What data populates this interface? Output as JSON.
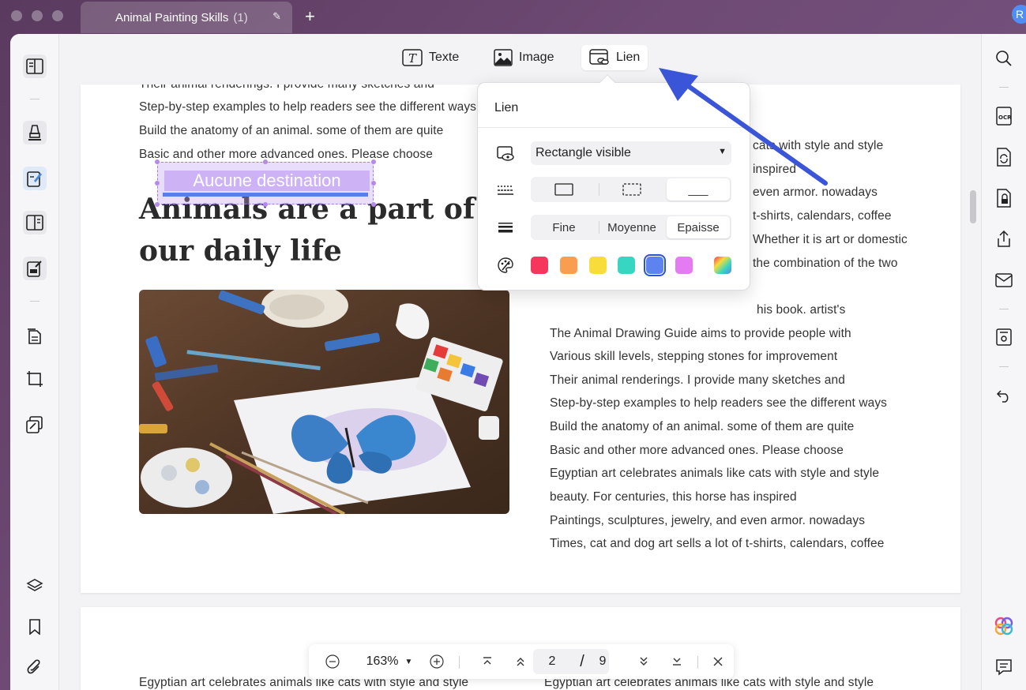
{
  "window": {
    "tab_title": "Animal Painting Skills",
    "tab_count": "(1)",
    "avatar_letter": "R"
  },
  "toolbar": {
    "text_label": "Texte",
    "image_label": "Image",
    "link_label": "Lien"
  },
  "popup": {
    "title": "Lien",
    "visibility_value": "Rectangle visible",
    "style_underline_label": "___",
    "thickness": [
      "Fine",
      "Moyenne",
      "Epaisse"
    ],
    "thickness_selected": "Epaisse",
    "colors": [
      "#f5375e",
      "#f99d4f",
      "#f7dc3a",
      "#36d6c2",
      "#5c83ee",
      "#e57bf2"
    ],
    "color_selected": "#5c83ee"
  },
  "document": {
    "link_placeholder": "Aucune destination",
    "heading": "Animals are a part of our daily life",
    "left_lines": [
      "Their animal renderings. I provide many sketches and",
      "Step-by-step examples to help readers see the different ways",
      "Build the anatomy of an animal. some of them are quite",
      "Basic and other more advanced ones. Please choose"
    ],
    "right_top_lines": [
      "cats with style and style",
      "inspired",
      "even armor. nowadays",
      "t-shirts, calendars, coffee",
      "Whether it is art or domestic",
      "the combination of the two"
    ],
    "right_lines": [
      "his book. artist's",
      "The Animal Drawing Guide aims to provide people with",
      "Various skill levels, stepping stones for improvement",
      "Their animal renderings. I provide many sketches and",
      "Step-by-step examples to help readers see the different ways",
      "Build the anatomy of an animal. some of them are quite",
      "Basic and other more advanced ones. Please choose",
      "Egyptian art celebrates animals like cats with style and style",
      "beauty. For centuries, this horse has inspired",
      "Paintings, sculptures, jewelry, and even armor. nowadays",
      "Times, cat and dog art sells a lot of t-shirts, calendars, coffee"
    ],
    "page2_left": "Egyptian art celebrates animals like cats with style and style",
    "page2_right": "Egyptian art celebrates animals like cats with style and style"
  },
  "navigation": {
    "zoom": "163%",
    "current_page": "2",
    "separator": "/",
    "total_pages": "9"
  }
}
